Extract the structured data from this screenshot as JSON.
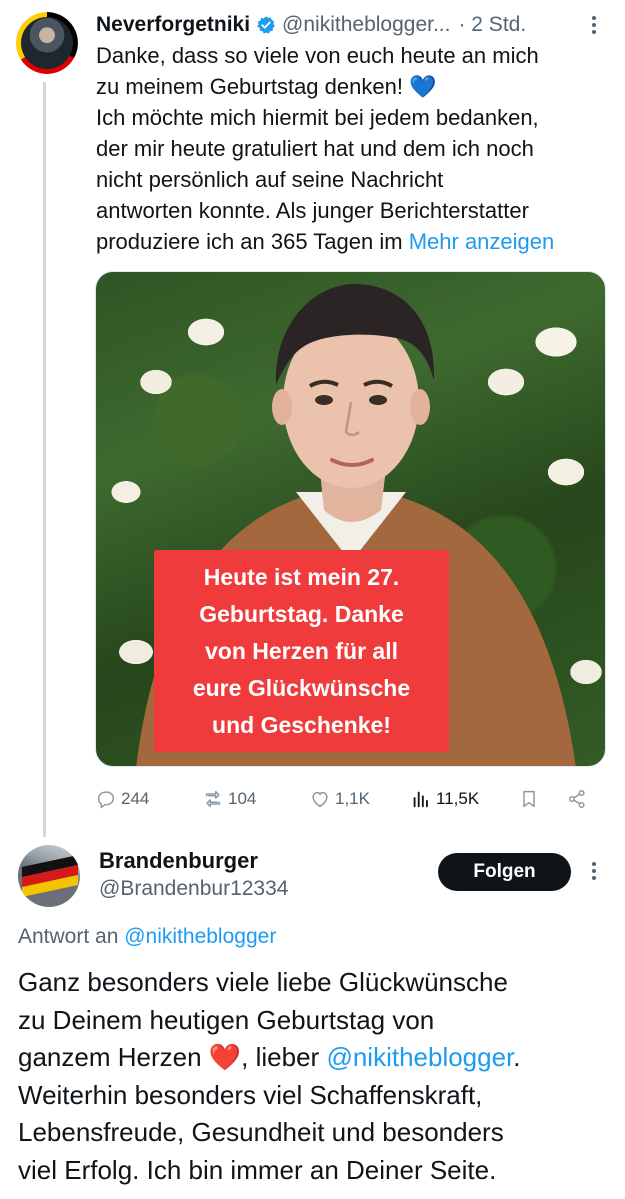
{
  "tweet": {
    "author_name": "Neverforgetniki",
    "author_handle": "@nikitheblogger...",
    "time": "· 2 Std.",
    "text_lines": [
      "Danke, dass so viele von euch heute an mich",
      "zu meinem Geburtstag denken! 💙",
      "Ich möchte mich hiermit bei jedem bedanken,",
      "der mir heute gratuliert hat und dem ich noch",
      "nicht persönlich auf seine Nachricht",
      "antworten konnte. Als junger Berichterstatter",
      "produziere ich an 365 Tagen im"
    ],
    "more_link": "Mehr anzeigen",
    "image_caption": "Heute ist mein 27.\nGeburtstag. Danke\nvon Herzen für all\neure Glückwünsche\nund Geschenke!",
    "stats": {
      "replies": "244",
      "reposts": "104",
      "likes": "1,1K",
      "views": "11,5K"
    }
  },
  "reply": {
    "author_name": "Brandenburger",
    "author_handle": "@Brandenbur12334",
    "follow_label": "Folgen",
    "reply_to_prefix": "Antwort an",
    "reply_to_handle": "@nikitheblogger",
    "line1": "Ganz besonders viele liebe Glückwünsche",
    "line2": "zu Deinem heutigen Geburtstag von",
    "line3_a": "ganzem Herzen",
    "line3_heart": "❤️",
    "line3_b": ", lieber",
    "line3_mention": "@nikitheblogger",
    "line3_c": ".",
    "line4": "Weiterhin besonders viel Schaffenskraft,",
    "line5": "Lebensfreude, Gesundheit und besonders",
    "line6": "viel Erfolg. Ich bin immer an Deiner Seite."
  },
  "colors": {
    "link": "#1d9bf0",
    "muted": "#536471",
    "caption_bg": "#ef3b3b",
    "verified": "#1d9bf0"
  }
}
